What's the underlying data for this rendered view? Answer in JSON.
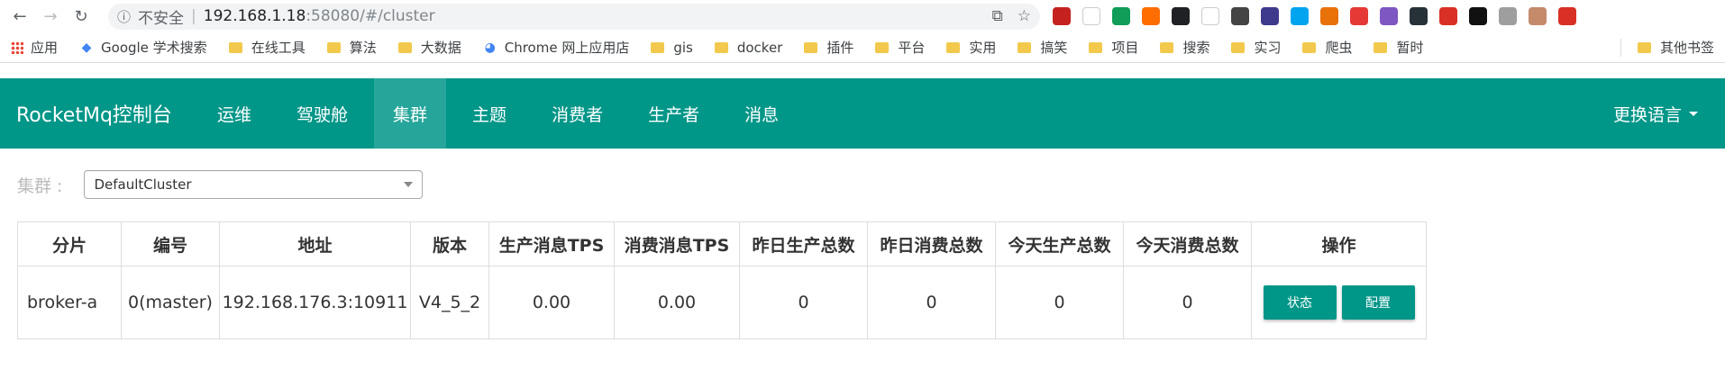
{
  "browser": {
    "nav": {
      "back_icon": "back-arrow-icon",
      "forward_icon": "forward-arrow-icon",
      "reload_icon": "reload-icon"
    },
    "address": {
      "security_label": "不安全",
      "separator": "|",
      "host": "192.168.1.18",
      "port_path": ":58080/#/cluster"
    },
    "extensions": [
      "#c5221f",
      "#ffffff",
      "#0f9d58",
      "#ff6d00",
      "#202124",
      "#ffffff",
      "#444444",
      "#3f3a8c",
      "#00a4ef",
      "#e8710a",
      "#e53935",
      "#7e57c2",
      "#263238",
      "#d93025",
      "#111111",
      "#9e9e9e",
      "#c48a6a",
      "#d93025"
    ],
    "bookmarks": [
      {
        "label": "应用",
        "icon": "apps-grid-icon"
      },
      {
        "label": "Google 学术搜索",
        "icon": "google-scholar-icon"
      },
      {
        "label": "在线工具",
        "icon": "folder-icon"
      },
      {
        "label": "算法",
        "icon": "folder-icon"
      },
      {
        "label": "大数据",
        "icon": "folder-icon"
      },
      {
        "label": "Chrome 网上应用店",
        "icon": "chrome-webstore-icon"
      },
      {
        "label": "gis",
        "icon": "folder-icon"
      },
      {
        "label": "docker",
        "icon": "folder-icon"
      },
      {
        "label": "插件",
        "icon": "folder-icon"
      },
      {
        "label": "平台",
        "icon": "folder-icon"
      },
      {
        "label": "实用",
        "icon": "folder-icon"
      },
      {
        "label": "搞笑",
        "icon": "folder-icon"
      },
      {
        "label": "项目",
        "icon": "folder-icon"
      },
      {
        "label": "搜索",
        "icon": "folder-icon"
      },
      {
        "label": "实习",
        "icon": "folder-icon"
      },
      {
        "label": "爬虫",
        "icon": "folder-icon"
      },
      {
        "label": "暂时",
        "icon": "folder-icon"
      }
    ],
    "other_bookmarks": "其他书签"
  },
  "app": {
    "brand": "RocketMq控制台",
    "nav": [
      {
        "label": "运维",
        "active": false
      },
      {
        "label": "驾驶舱",
        "active": false
      },
      {
        "label": "集群",
        "active": true
      },
      {
        "label": "主题",
        "active": false
      },
      {
        "label": "消费者",
        "active": false
      },
      {
        "label": "生产者",
        "active": false
      },
      {
        "label": "消息",
        "active": false
      }
    ],
    "language": "更换语言",
    "accent": "#009688"
  },
  "cluster": {
    "label": "集群 :",
    "selected": "DefaultCluster"
  },
  "table": {
    "headers": [
      "分片",
      "编号",
      "地址",
      "版本",
      "生产消息TPS",
      "消费消息TPS",
      "昨日生产总数",
      "昨日消费总数",
      "今天生产总数",
      "今天消费总数",
      "操作"
    ],
    "rows": [
      {
        "shard": "broker-a",
        "id": "0(master)",
        "address": "192.168.176.3:10911",
        "version": "V4_5_2",
        "produce_tps": "0.00",
        "consume_tps": "0.00",
        "yesterday_produce": "0",
        "yesterday_consume": "0",
        "today_produce": "0",
        "today_consume": "0"
      }
    ],
    "actions": {
      "status": "状态",
      "config": "配置"
    }
  }
}
